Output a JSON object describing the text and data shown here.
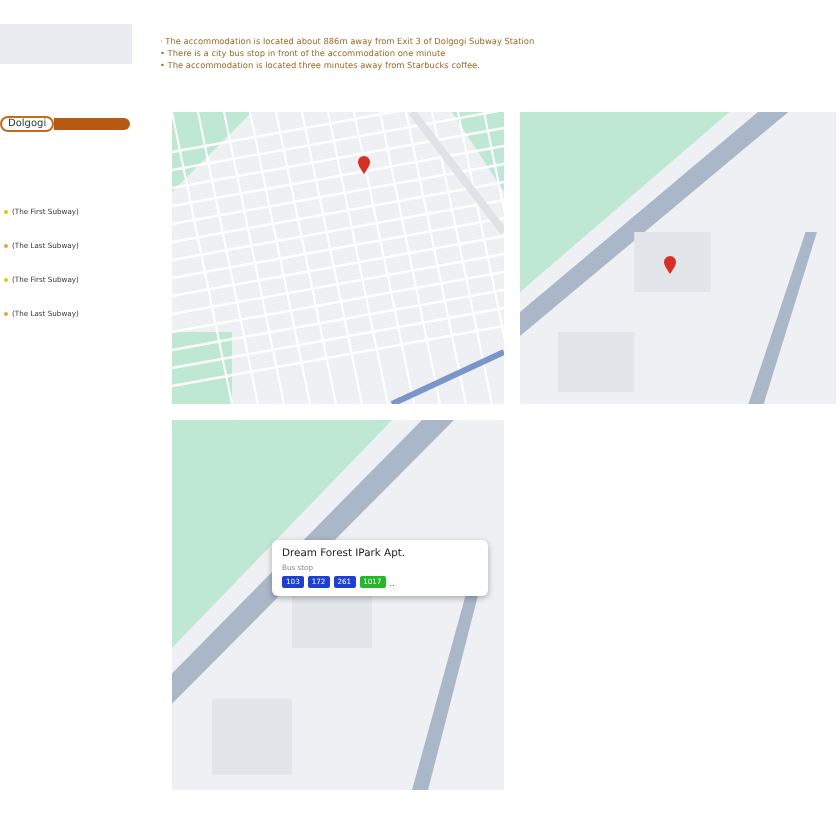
{
  "notes": [
    "· The accommodation is located about 886m away from Exit 3 of Dolgogi Subway Station",
    "• There is a city bus stop in front of the accommodation one minute",
    "• The accommodation is located three minutes away from Starbucks coffee."
  ],
  "sidebar": {
    "station_tag": "Dolgogi",
    "schedule": [
      {
        "label": "(The First Subway)",
        "color": "#c8d400"
      },
      {
        "label": "(The Last Subway)",
        "color": "#e8a33a"
      },
      {
        "label": "(The First Subway)",
        "color": "#c8d400"
      },
      {
        "label": "(The Last Subway)",
        "color": "#e8a33a"
      }
    ]
  },
  "bus_stop": {
    "name": "Dream Forest IPark Apt.",
    "type": "Bus stop",
    "routes": [
      {
        "number": "103",
        "color": "#1f3fd0"
      },
      {
        "number": "172",
        "color": "#1f3fd0"
      },
      {
        "number": "261",
        "color": "#1f3fd0"
      },
      {
        "number": "1017",
        "color": "#27b52a"
      }
    ],
    "more": ".."
  }
}
